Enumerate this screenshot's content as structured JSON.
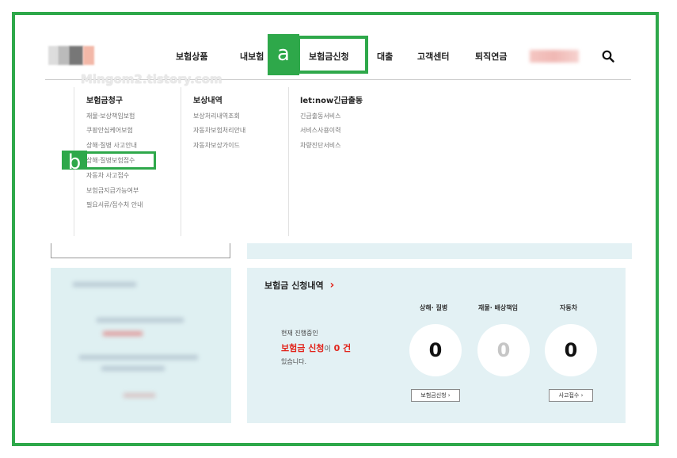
{
  "watermark": "Mingom2.tistory.com",
  "nav": {
    "items": [
      "보험상품",
      "내보험",
      "보험금신청",
      "대출",
      "고객센터",
      "퇴직연금"
    ],
    "active": "보험금신청"
  },
  "annotations": {
    "a": "a",
    "b": "b"
  },
  "menu": {
    "col1": {
      "title": "보험금청구",
      "items": [
        "재물·보상책임보험",
        "쿠팡안심케어보험",
        "상해·질병 사고안내",
        "상해·질병보험접수",
        "자동차 사고접수",
        "보험금지급가능여부",
        "필요서류/접수처 안내"
      ]
    },
    "col2": {
      "title": "보상내역",
      "items": [
        "보상처리내역조회",
        "자동차보험처리안내",
        "자동차보상가이드"
      ]
    },
    "col3": {
      "title": "let:now긴급출동",
      "items": [
        "긴급출동서비스",
        "서비스사용이력",
        "차량진단서비스"
      ]
    }
  },
  "claims": {
    "title": "보험금 신청내역",
    "title_arrow": "›",
    "desc_line1": "현재 진행중인",
    "highlight": "보험금 신청",
    "particle": "이",
    "count_text": "0 건",
    "desc_line3": "있습니다.",
    "categories": [
      {
        "label": "상해· 질병",
        "count": "0"
      },
      {
        "label": "재물· 배상책임",
        "count": "0"
      },
      {
        "label": "자동차",
        "count": "0"
      }
    ],
    "apply_button": "보험금신청 ›",
    "accident_button": "사고접수 ›"
  },
  "colors": {
    "accent_green": "#2ea84a",
    "highlight_red": "#e2231a",
    "panel_bg": "#e3f1f4"
  }
}
